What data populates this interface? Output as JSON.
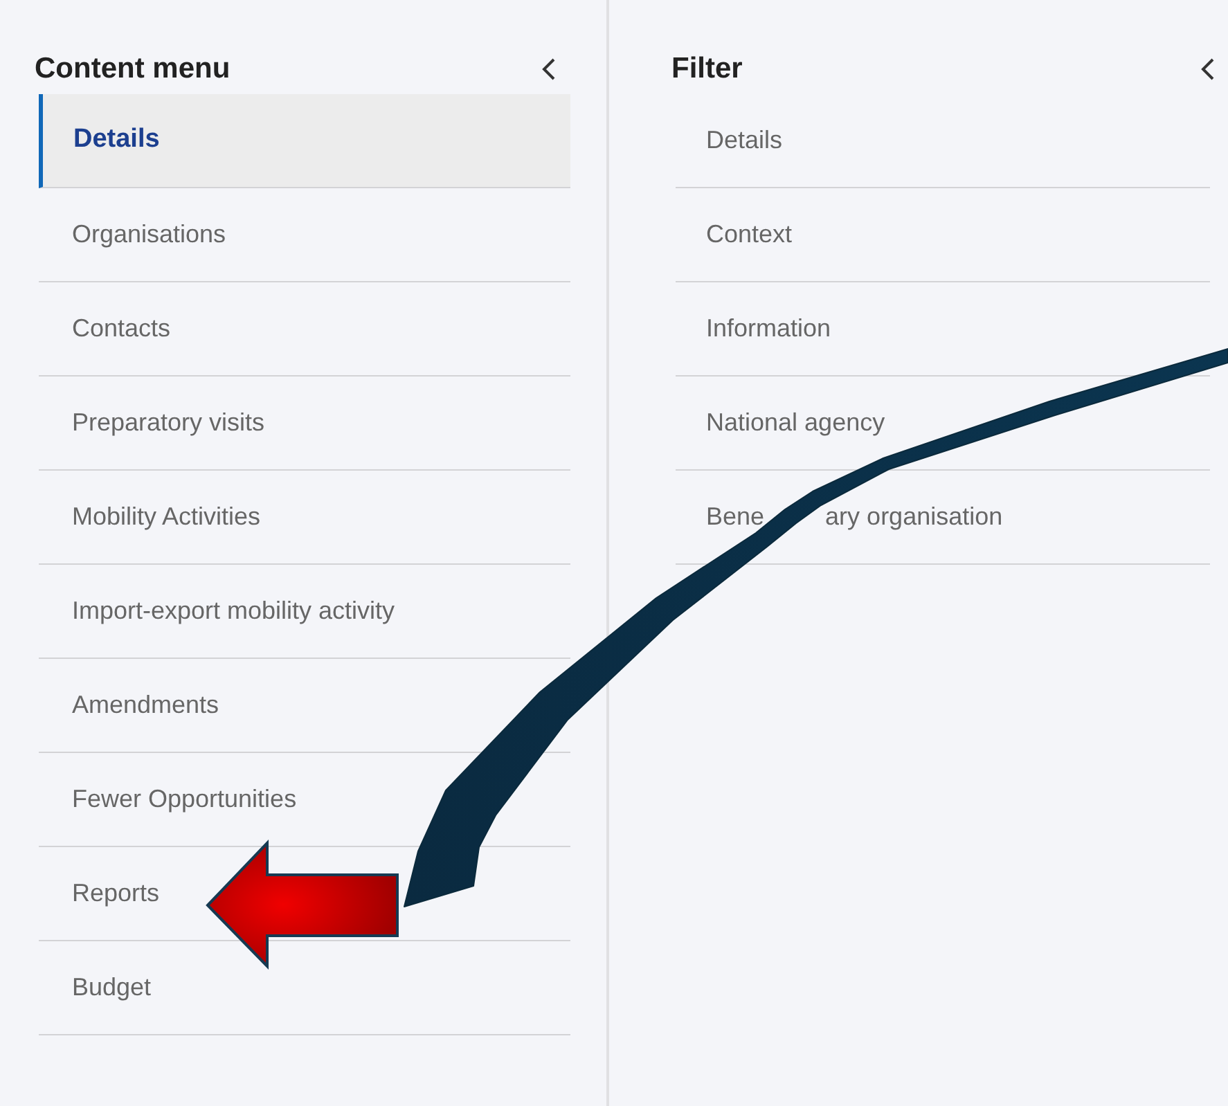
{
  "content_menu": {
    "title": "Content menu",
    "items": [
      {
        "label": "Details",
        "selected": true
      },
      {
        "label": "Organisations",
        "selected": false
      },
      {
        "label": "Contacts",
        "selected": false
      },
      {
        "label": "Preparatory visits",
        "selected": false
      },
      {
        "label": "Mobility Activities",
        "selected": false
      },
      {
        "label": "Import-export mobility activity",
        "selected": false
      },
      {
        "label": "Amendments",
        "selected": false
      },
      {
        "label": "Fewer Opportunities",
        "selected": false
      },
      {
        "label": "Reports",
        "selected": false
      },
      {
        "label": "Budget",
        "selected": false
      }
    ]
  },
  "filter": {
    "title": "Filter",
    "items": [
      {
        "label": "Details"
      },
      {
        "label": "Context"
      },
      {
        "label": "Information"
      },
      {
        "label": "National agency"
      },
      {
        "label": "Bene",
        "label_after_arrow": "ary organisation"
      }
    ]
  }
}
